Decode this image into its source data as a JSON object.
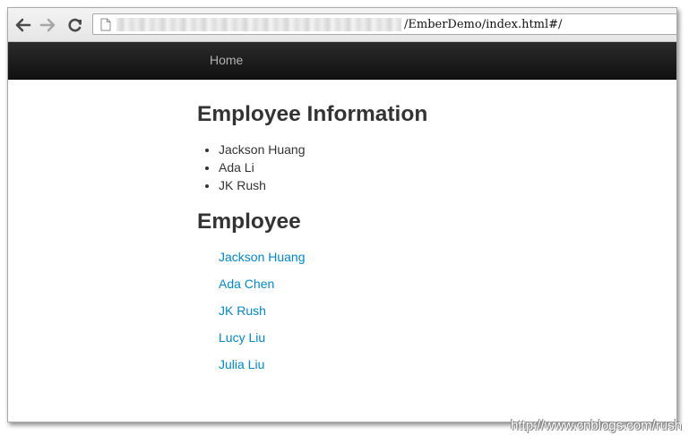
{
  "browser": {
    "back_icon": "back-arrow-icon",
    "forward_icon": "forward-arrow-icon",
    "reload_icon": "reload-icon",
    "page_icon": "page-icon",
    "url_visible": "/EmberDemo/index.html#/"
  },
  "navbar": {
    "home_label": "Home"
  },
  "main": {
    "info_heading": "Employee Information",
    "info_items": [
      "Jackson Huang",
      "Ada Li",
      "JK Rush"
    ],
    "employee_heading": "Employee",
    "employee_links": [
      "Jackson Huang",
      "Ada Chen",
      "JK Rush",
      "Lucy Liu",
      "Julia Liu"
    ]
  },
  "watermark": "http://www.cnblogs.com/rush",
  "colors": {
    "navbar_bg": "#1b1b1b",
    "nav_text": "#b3b3b3",
    "heading_text": "#333333",
    "link": "#0088cc"
  }
}
